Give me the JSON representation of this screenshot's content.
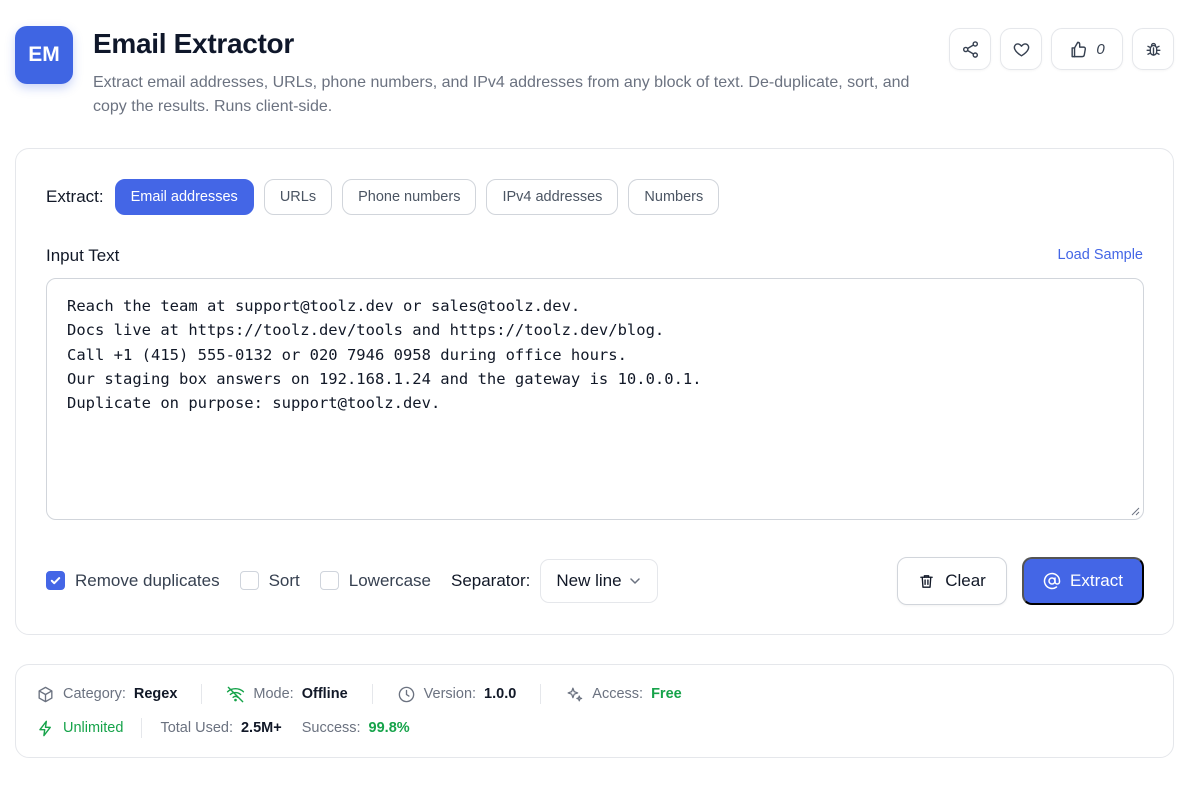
{
  "app": {
    "logo_text": "EM",
    "title": "Email Extractor",
    "description": "Extract email addresses, URLs, phone numbers, and IPv4 addresses from any block of text. De-duplicate, sort, and copy the results. Runs client-side."
  },
  "header_actions": {
    "like_count": "0",
    "icons": [
      "share-icon",
      "heart-icon",
      "thumbs-up-icon",
      "bug-icon"
    ]
  },
  "extract": {
    "label": "Extract:",
    "modes": [
      "Email addresses",
      "URLs",
      "Phone numbers",
      "IPv4 addresses",
      "Numbers"
    ],
    "active_mode": "Email addresses"
  },
  "input": {
    "label": "Input Text",
    "load_sample": "Load Sample",
    "lines": [
      "Reach the team at support@toolz.dev or sales@toolz.dev.",
      "Docs live at https://toolz.dev/tools and https://toolz.dev/blog.",
      "Call +1 (415) 555-0132 or 020 7946 0958 during office hours.",
      "Our staging box answers on 192.168.1.24 and the gateway is 10.0.0.1.",
      "Duplicate on purpose: support@toolz.dev."
    ]
  },
  "options": {
    "remove_duplicates": {
      "label": "Remove duplicates",
      "checked": true
    },
    "sort": {
      "label": "Sort",
      "checked": false
    },
    "lowercase": {
      "label": "Lowercase",
      "checked": false
    },
    "separator_label": "Separator:",
    "separator_value": "New line"
  },
  "actions": {
    "clear": "Clear",
    "extract": "Extract"
  },
  "info": {
    "category_key": "Category:",
    "category_val": "Regex",
    "mode_key": "Mode:",
    "mode_val": "Offline",
    "version_key": "Version:",
    "version_val": "1.0.0",
    "access_key": "Access:",
    "access_val": "Free",
    "unlimited": "Unlimited",
    "total_used_key": "Total Used:",
    "total_used_val": "2.5M+",
    "success_key": "Success:",
    "success_val": "99.8%"
  },
  "colors": {
    "accent": "#4466e6",
    "success": "#16a34a"
  }
}
